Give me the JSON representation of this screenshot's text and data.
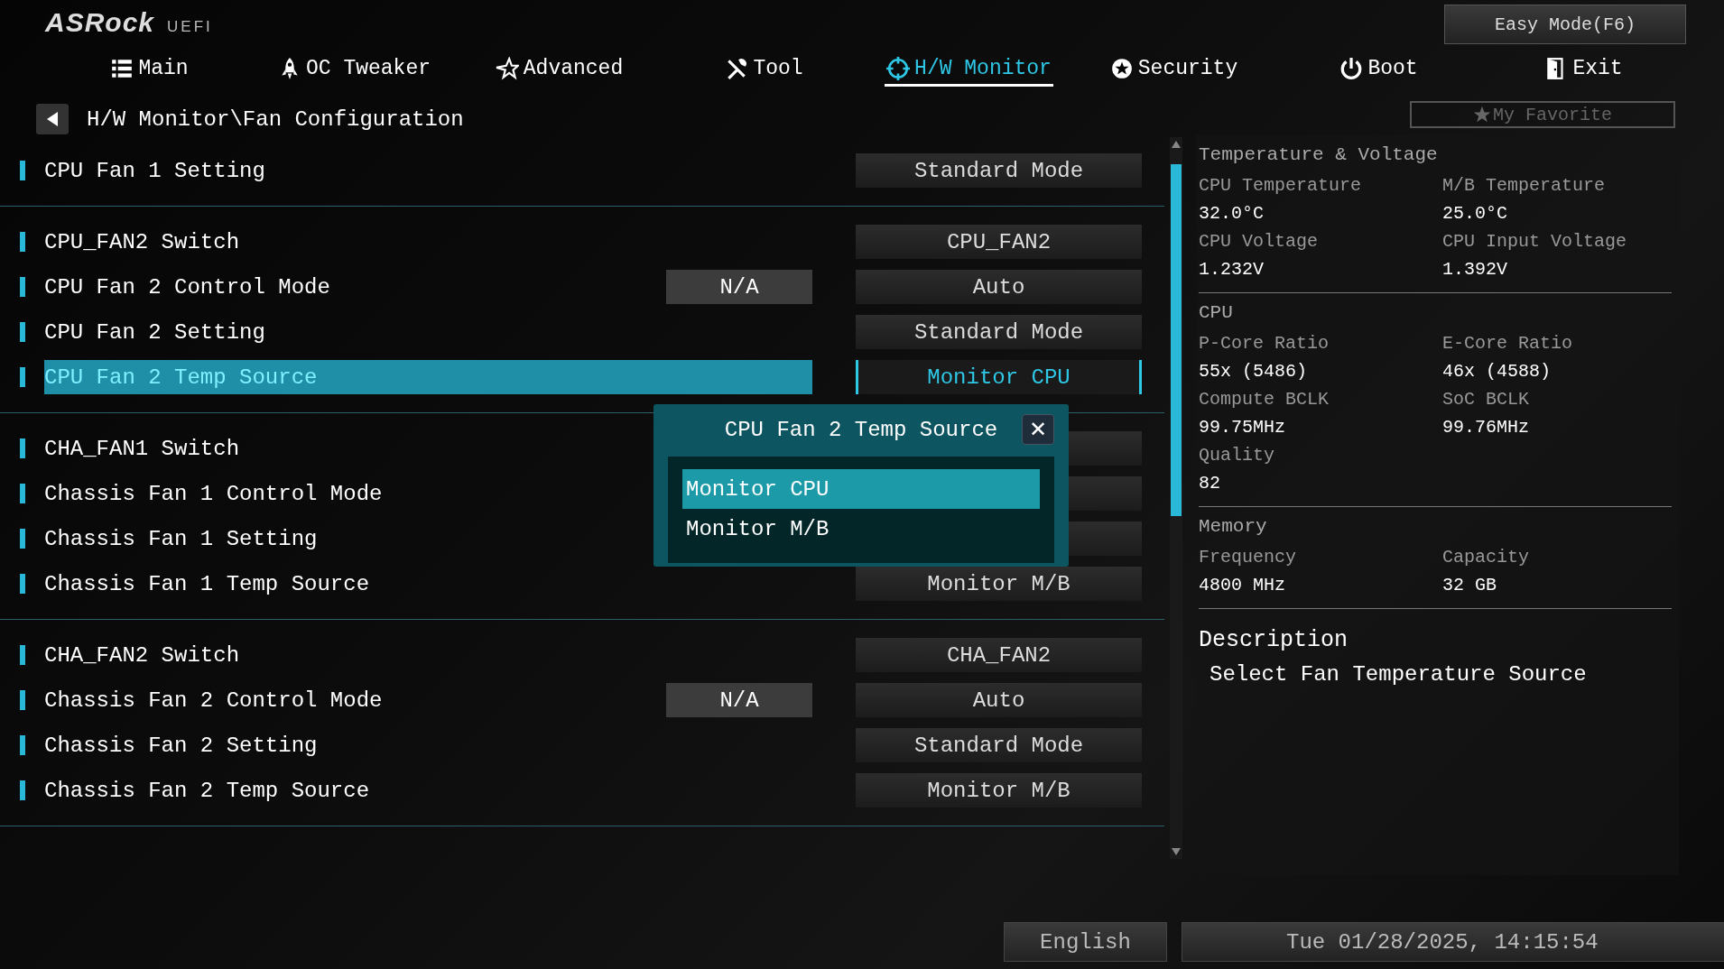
{
  "header": {
    "logo": "ASRock",
    "logo_suffix": "UEFI",
    "easy_mode": "Easy Mode(F6)"
  },
  "tabs": [
    {
      "label": "Main",
      "selected": false
    },
    {
      "label": "OC Tweaker",
      "selected": false
    },
    {
      "label": "Advanced",
      "selected": false
    },
    {
      "label": "Tool",
      "selected": false
    },
    {
      "label": "H/W Monitor",
      "selected": true
    },
    {
      "label": "Security",
      "selected": false
    },
    {
      "label": "Boot",
      "selected": false
    },
    {
      "label": "Exit",
      "selected": false
    }
  ],
  "breadcrumb": "H/W Monitor\\Fan Configuration",
  "favorite": "My Favorite",
  "sections": [
    {
      "rows": [
        {
          "label": "CPU Fan 1 Setting",
          "value": "Standard Mode",
          "selected": false
        }
      ]
    },
    {
      "rows": [
        {
          "label": "CPU_FAN2 Switch",
          "value": "CPU_FAN2",
          "selected": false
        },
        {
          "label": "CPU Fan 2 Control Mode",
          "reading": "N/A",
          "value": "Auto",
          "selected": false
        },
        {
          "label": "CPU Fan 2 Setting",
          "value": "Standard Mode",
          "selected": false
        },
        {
          "label": "CPU Fan 2 Temp Source",
          "value": "Monitor CPU",
          "selected": true
        }
      ]
    },
    {
      "rows": [
        {
          "label": "CHA_FAN1 Switch",
          "selected": false
        },
        {
          "label": "Chassis Fan 1 Control Mode",
          "selected": false
        },
        {
          "label": "Chassis Fan 1 Setting",
          "selected": false
        },
        {
          "label": "Chassis Fan 1 Temp Source",
          "value": "Monitor M/B",
          "selected": false
        }
      ]
    },
    {
      "rows": [
        {
          "label": "CHA_FAN2 Switch",
          "value": "CHA_FAN2",
          "selected": false
        },
        {
          "label": "Chassis Fan 2 Control Mode",
          "reading": "N/A",
          "value": "Auto",
          "selected": false
        },
        {
          "label": "Chassis Fan 2 Setting",
          "value": "Standard Mode",
          "selected": false
        },
        {
          "label": "Chassis Fan 2 Temp Source",
          "value": "Monitor M/B",
          "selected": false
        }
      ]
    }
  ],
  "popup": {
    "title": "CPU Fan 2 Temp Source",
    "close": "✕",
    "options": [
      {
        "label": "Monitor CPU",
        "selected": true
      },
      {
        "label": "Monitor M/B",
        "selected": false
      }
    ]
  },
  "monitor": [
    {
      "title": "Temperature & Voltage",
      "items": [
        {
          "label": "CPU Temperature",
          "value": "32.0°C"
        },
        {
          "label": "M/B Temperature",
          "value": "25.0°C"
        },
        {
          "label": "CPU Voltage",
          "value": "1.232V"
        },
        {
          "label": "CPU Input Voltage",
          "value": "1.392V"
        }
      ]
    },
    {
      "title": "CPU",
      "items": [
        {
          "label": "P-Core Ratio",
          "value": "55x (5486)"
        },
        {
          "label": "E-Core Ratio",
          "value": "46x (4588)"
        },
        {
          "label": "Compute BCLK",
          "value": "99.75MHz"
        },
        {
          "label": "SoC BCLK",
          "value": "99.76MHz"
        },
        {
          "label": "Quality",
          "value": "82"
        }
      ]
    },
    {
      "title": "Memory",
      "items": [
        {
          "label": "Frequency",
          "value": "4800 MHz"
        },
        {
          "label": "Capacity",
          "value": "32 GB"
        }
      ]
    }
  ],
  "description": {
    "title": "Description",
    "text": "Select Fan Temperature Source"
  },
  "footer": {
    "language": "English",
    "datetime": "Tue 01/28/2025, 14:15:54"
  }
}
